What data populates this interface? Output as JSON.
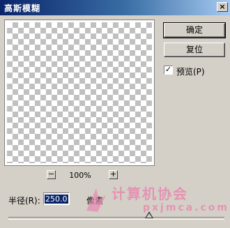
{
  "window": {
    "title": "高斯模糊"
  },
  "buttons": {
    "ok": "确定",
    "reset": "复位"
  },
  "preview": {
    "checked": true,
    "label": "预览(P)"
  },
  "zoom": {
    "minus": "−",
    "plus": "+",
    "level": "100%"
  },
  "radius": {
    "label": "半径(R):",
    "value": "250.0",
    "unit": "像素",
    "slider_fraction": 0.65
  },
  "watermark": {
    "title": "计算机协会",
    "url": "pxjmca.com"
  },
  "colors": {
    "title_start": "#0a246a",
    "title_end": "#a6caf0",
    "face": "#d4d0c8",
    "watermark": "#e889b0"
  }
}
